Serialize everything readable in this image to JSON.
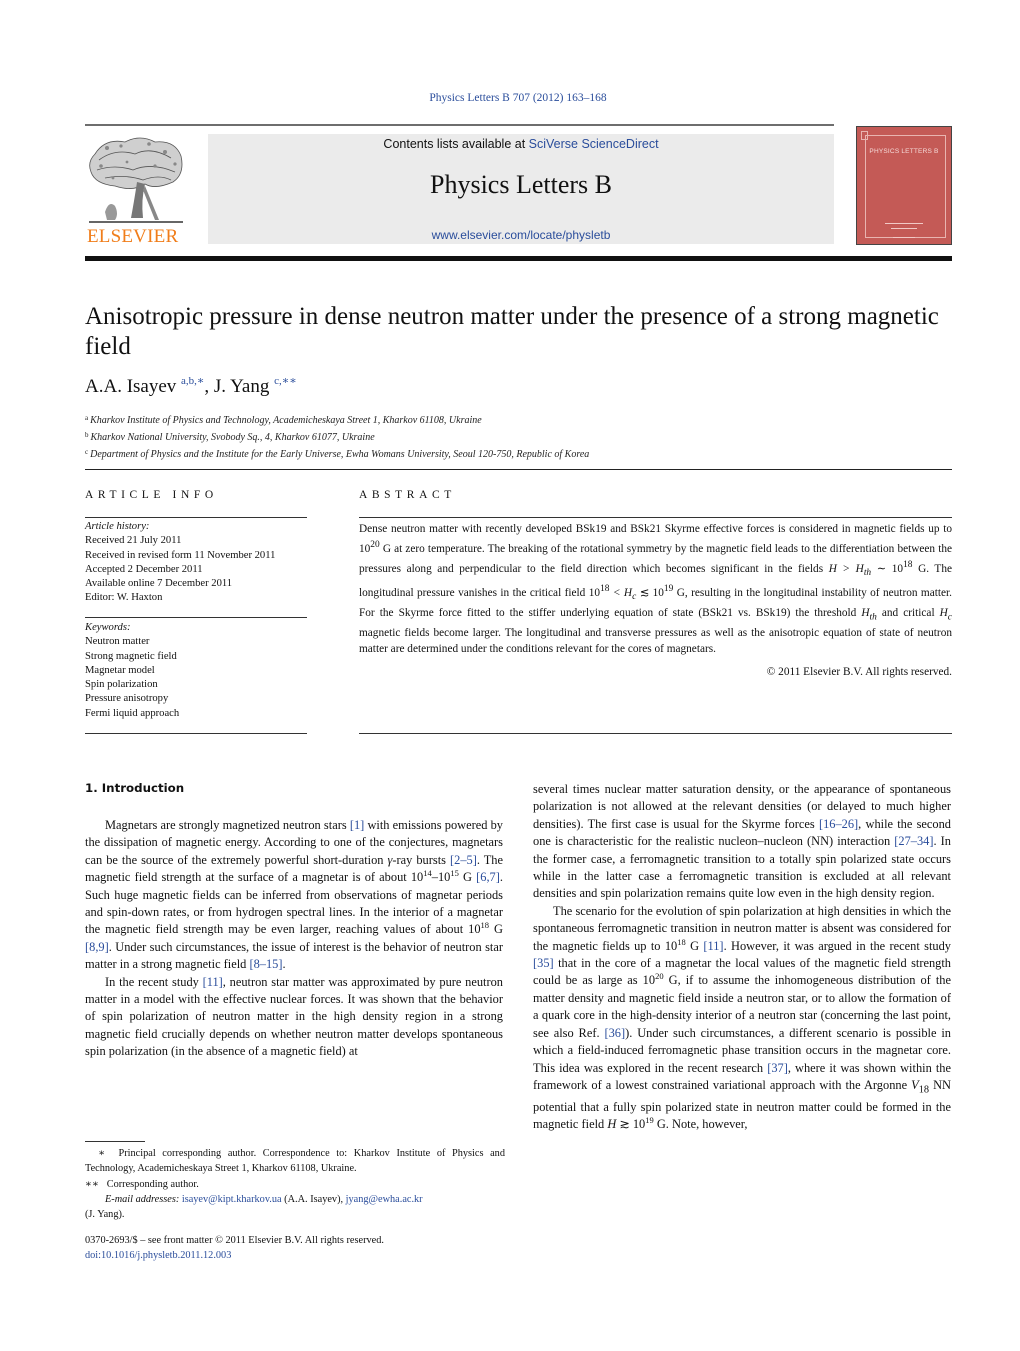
{
  "header": {
    "journal_ref": "Physics Letters B 707 (2012) 163–168",
    "contents_prefix": "Contents lists available at ",
    "contents_link": "SciVerse ScienceDirect",
    "journal_title": "Physics Letters B",
    "journal_url": "www.elsevier.com/locate/physletb",
    "publisher_logo_text": "ELSEVIER",
    "cover_title": "PHYSICS LETTERS B",
    "colors": {
      "link": "#2a4d9b",
      "elsevier_orange": "#f07d1a",
      "cover_red": "#c45a56",
      "banner_gray": "#ebebeb"
    }
  },
  "article": {
    "title": "Anisotropic pressure in dense neutron matter under the presence of a strong magnetic field",
    "authors": [
      {
        "name": "A.A. Isayev",
        "marks": "a,b,∗",
        "sep": ", "
      },
      {
        "name": "J. Yang",
        "marks": "c,∗∗",
        "sep": ""
      }
    ],
    "affiliations": [
      {
        "mark": "a",
        "text": "Kharkov Institute of Physics and Technology, Academicheskaya Street 1, Kharkov 61108, Ukraine"
      },
      {
        "mark": "b",
        "text": "Kharkov National University, Svobody Sq., 4, Kharkov 61077, Ukraine"
      },
      {
        "mark": "c",
        "text": "Department of Physics and the Institute for the Early Universe, Ewha Womans University, Seoul 120-750, Republic of Korea"
      }
    ]
  },
  "article_info": {
    "label": "ARTICLE INFO",
    "history_heading": "Article history:",
    "history": [
      "Received 21 July 2011",
      "Received in revised form 11 November 2011",
      "Accepted 2 December 2011",
      "Available online 7 December 2011",
      "Editor: W. Haxton"
    ],
    "keywords_heading": "Keywords:",
    "keywords": [
      "Neutron matter",
      "Strong magnetic field",
      "Magnetar model",
      "Spin polarization",
      "Pressure anisotropy",
      "Fermi liquid approach"
    ]
  },
  "abstract": {
    "label": "ABSTRACT",
    "parts": [
      "Dense neutron matter with recently developed BSk19 and BSk21 Skyrme effective forces is considered in magnetic fields up to 10",
      "20",
      " G at zero temperature. The breaking of the rotational symmetry by the magnetic field leads to the differentiation between the pressures along and perpendicular to the field direction which becomes significant in the fields ",
      "H > H",
      "th",
      " ∼ 10",
      "18",
      " G. The longitudinal pressure vanishes in the critical field 10",
      "18",
      " < H",
      "c",
      " ≲ 10",
      "19",
      " G, resulting in the longitudinal instability of neutron matter. For the Skyrme force fitted to the stiffer underlying equation of state (BSk21 vs. BSk19) the threshold ",
      "H",
      "th",
      " and critical ",
      "H",
      "c",
      " magnetic fields become larger. The longitudinal and transverse pressures as well as the anisotropic equation of state of neutron matter are determined under the conditions relevant for the cores of magnetars."
    ],
    "copyright": "© 2011 Elsevier B.V. All rights reserved."
  },
  "body": {
    "section_heading": "1.  Introduction",
    "left": [
      "Magnetars are strongly magnetized neutron stars ",
      "[1]",
      " with emissions powered by the dissipation of magnetic energy. According to one of the conjectures, magnetars can be the source of the extremely powerful short-duration ",
      "γ",
      "-ray bursts ",
      "[2–5]",
      ". The magnetic field strength at the surface of a magnetar is of about 10",
      "14",
      "–10",
      "15",
      " G ",
      "[6,7]",
      ". Such huge magnetic fields can be inferred from observations of magnetar periods and spin-down rates, or from hydrogen spectral lines. In the interior of a magnetar the magnetic field strength may be even larger, reaching values of about 10",
      "18",
      " G ",
      "[8,9]",
      ". Under such circumstances, the issue of interest is the behavior of neutron star matter in a strong magnetic field ",
      "[8–15]",
      ".",
      "In the recent study ",
      "[11]",
      ", neutron star matter was approximated by pure neutron matter in a model with the effective nuclear forces. It was shown that the behavior of spin polarization of neutron matter in the high density region in a strong magnetic field crucially depends on whether neutron matter develops spontaneous spin polarization (in the absence of a magnetic field) at"
    ],
    "right": [
      "several times nuclear matter saturation density, or the appearance of spontaneous polarization is not allowed at the relevant densities (or delayed to much higher densities). The first case is usual for the Skyrme forces ",
      "[16–26]",
      ", while the second one is characteristic for the realistic nucleon–nucleon (NN) interaction ",
      "[27–34]",
      ". In the former case, a ferromagnetic transition to a totally spin polarized state occurs while in the latter case a ferromagnetic transition is excluded at all relevant densities and spin polarization remains quite low even in the high density region.",
      "The scenario for the evolution of spin polarization at high densities in which the spontaneous ferromagnetic transition in neutron matter is absent was considered for the magnetic fields up to 10",
      "18",
      " G ",
      "[11]",
      ". However, it was argued in the recent study ",
      "[35]",
      " that in the core of a magnetar the local values of the magnetic field strength could be as large as 10",
      "20",
      " G, if to assume the inhomogeneous distribution of the matter density and magnetic field inside a neutron star, or to allow the formation of a quark core in the high-density interior of a neutron star (concerning the last point, see also Ref. ",
      "[36]",
      "). Under such circumstances, a different scenario is possible in which a field-induced ferromagnetic phase transition occurs in the magnetar core. This idea was explored in the recent research ",
      "[37]",
      ", where it was shown within the framework of a lowest constrained variational approach with the Argonne ",
      "V",
      "18",
      " NN potential that a fully spin polarized state in neutron matter could be formed in the magnetic field ",
      "H",
      " ≳ 10",
      "19",
      " G. Note, however,"
    ]
  },
  "footnotes": {
    "star1_mark": "∗",
    "star1_text": "Principal corresponding author. Correspondence to: Kharkov Institute of Physics and Technology, Academicheskaya Street 1, Kharkov 61108, Ukraine.",
    "star2_mark": "∗∗",
    "star2_text": "Corresponding author.",
    "email_label": "E-mail addresses:",
    "email1": "isayev@kipt.kharkov.ua",
    "email1_owner": " (A.A. Isayev), ",
    "email2": "jyang@ewha.ac.kr",
    "email2_owner": "(J. Yang)."
  },
  "front_matter": {
    "issn_line": "0370-2693/$ – see front matter  © 2011 Elsevier B.V. All rights reserved.",
    "doi": "doi:10.1016/j.physletb.2011.12.003"
  }
}
